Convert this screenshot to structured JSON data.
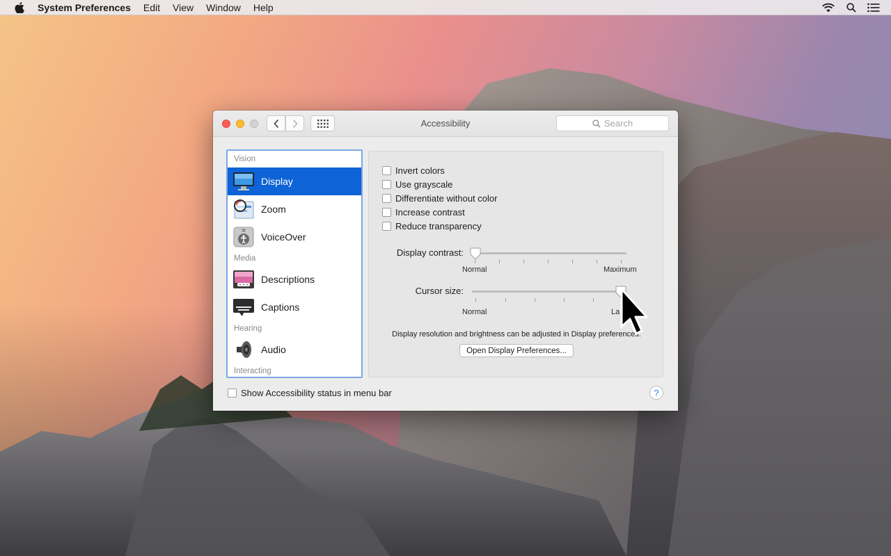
{
  "menubar": {
    "app_name": "System Preferences",
    "menus": [
      "Edit",
      "View",
      "Window",
      "Help"
    ]
  },
  "window": {
    "title": "Accessibility",
    "search_placeholder": "Search"
  },
  "sidebar": {
    "sections": [
      {
        "label": "Vision",
        "items": [
          {
            "label": "Display",
            "icon": "display-icon",
            "selected": true
          },
          {
            "label": "Zoom",
            "icon": "zoom-icon"
          },
          {
            "label": "VoiceOver",
            "icon": "voiceover-icon"
          }
        ]
      },
      {
        "label": "Media",
        "items": [
          {
            "label": "Descriptions",
            "icon": "descriptions-icon"
          },
          {
            "label": "Captions",
            "icon": "captions-icon"
          }
        ]
      },
      {
        "label": "Hearing",
        "items": [
          {
            "label": "Audio",
            "icon": "audio-icon"
          }
        ]
      },
      {
        "label": "Interacting",
        "items": []
      }
    ]
  },
  "display_options": {
    "checkboxes": [
      {
        "label": "Invert colors",
        "checked": false
      },
      {
        "label": "Use grayscale",
        "checked": false
      },
      {
        "label": "Differentiate without color",
        "checked": false
      },
      {
        "label": "Increase contrast",
        "checked": false
      },
      {
        "label": "Reduce transparency",
        "checked": false
      }
    ],
    "contrast_slider": {
      "label": "Display contrast:",
      "min_label": "Normal",
      "max_label": "Maximum",
      "value": 0
    },
    "cursor_slider": {
      "label": "Cursor size:",
      "min_label": "Normal",
      "max_label": "La",
      "value": 1
    },
    "note": "Display resolution and brightness can be adjusted in Display preferences:",
    "open_button": "Open Display Preferences..."
  },
  "footer": {
    "status_checkbox": "Show Accessibility status in menu bar",
    "status_checked": false,
    "help": "?"
  }
}
